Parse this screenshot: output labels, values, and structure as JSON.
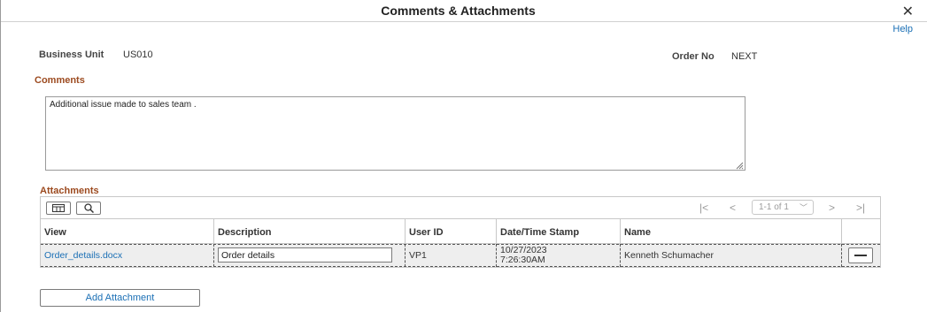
{
  "dialog": {
    "title": "Comments & Attachments",
    "close_glyph": "✕",
    "help_label": "Help"
  },
  "header": {
    "business_unit_label": "Business Unit",
    "business_unit_value": "US010",
    "order_no_label": "Order No",
    "order_no_value": "NEXT"
  },
  "comments": {
    "section_title": "Comments",
    "text": "Additional issue made to sales team ."
  },
  "attachments": {
    "section_title": "Attachments",
    "toolbar": {
      "personalize_icon": "grid-settings-icon",
      "search_icon": "search-icon"
    },
    "pagination": {
      "first": "|<",
      "prev": "<",
      "range": "1-1 of 1",
      "next": ">",
      "last": ">|"
    },
    "columns": [
      "View",
      "Description",
      "User ID",
      "Date/Time Stamp",
      "Name"
    ],
    "rows": [
      {
        "view": "Order_details.docx",
        "description": "Order details",
        "user_id": "VP1",
        "date": "10/27/2023",
        "time": "7:26:30AM",
        "name": "Kenneth Schumacher"
      }
    ],
    "add_button": "Add Attachment"
  },
  "colors": {
    "section_heading": "#9c4a1f",
    "link": "#1a6fb5"
  }
}
